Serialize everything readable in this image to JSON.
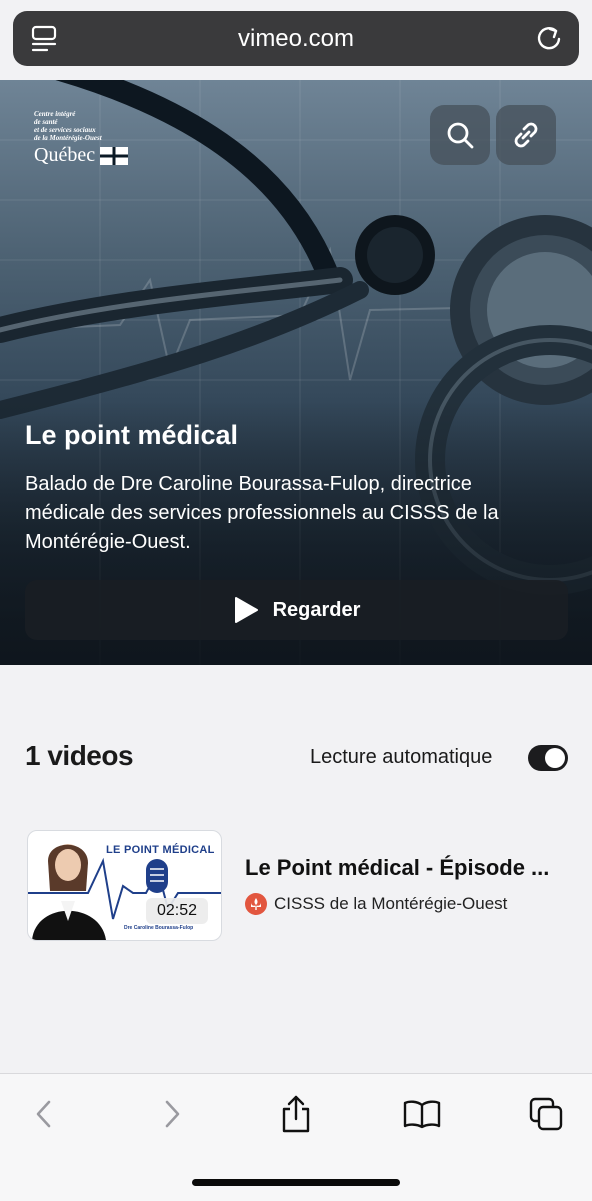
{
  "browser": {
    "url": "vimeo.com",
    "reader_icon": "reader-icon",
    "reload_icon": "reload-icon"
  },
  "hero": {
    "logo": {
      "lines": [
        "Centre intégré",
        "de santé",
        "et de services sociaux",
        "de la Montérégie-Ouest"
      ],
      "name": "Québec"
    },
    "title": "Le point médical",
    "description": "Balado de Dre Caroline Bourassa-Fulop, directrice médicale des services professionnels au CISSS de la Montérégie-Ouest.",
    "watch_label": "Regarder"
  },
  "videos": {
    "count_label": "1 videos",
    "autoplay_label": "Lecture automatique",
    "autoplay_on": true,
    "items": [
      {
        "thumb_title": "LE POINT MÉDICAL",
        "thumb_subtitle": "Dre Caroline Bourassa-Fulop",
        "duration": "02:52",
        "title": "Le Point médical - Épisode ...",
        "channel": "CISSS de la Montérégie-Ouest"
      }
    ]
  },
  "toolbar": {
    "back": "back-icon",
    "forward": "forward-icon",
    "share": "share-icon",
    "bookmarks": "bookmarks-icon",
    "tabs": "tabs-icon"
  },
  "colors": {
    "accent_dark": "#1c1c1e",
    "brand_blue": "#1f3f8a",
    "channel_badge": "#e2563f"
  }
}
